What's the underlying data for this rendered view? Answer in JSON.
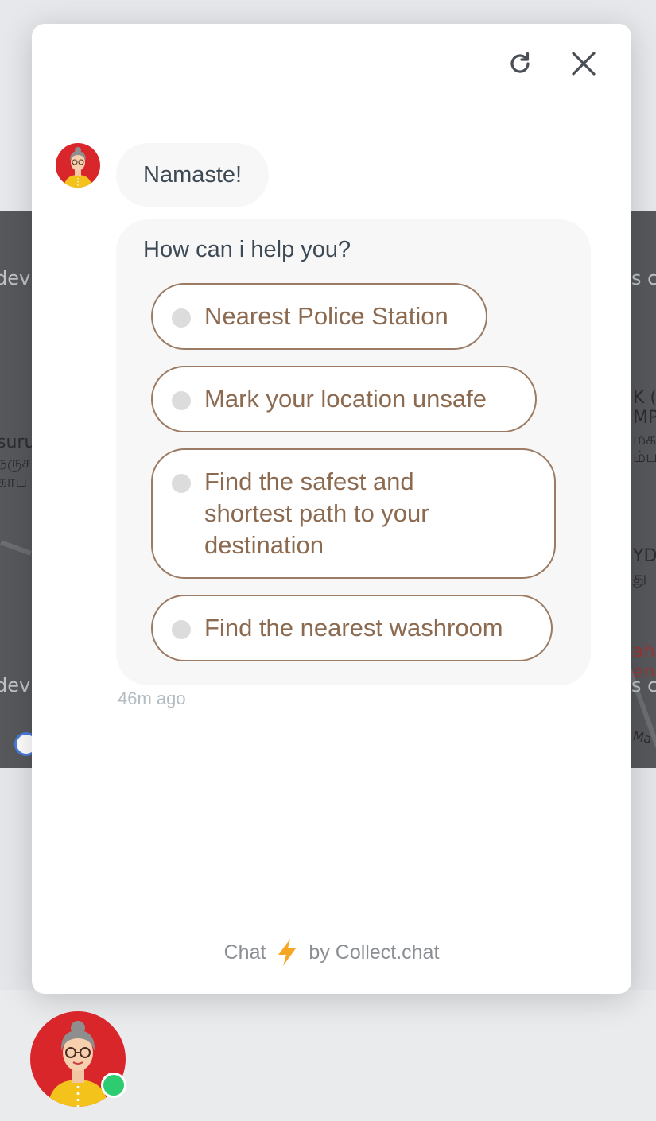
{
  "background": {
    "map_labels": [
      "dev",
      "dev",
      "s c",
      "s c",
      "suru",
      "நருச",
      "காப",
      "K (",
      "MP",
      "மக",
      "ம்ப",
      "YD",
      "து",
      "aha",
      "enc",
      "Ma"
    ]
  },
  "header": {
    "refresh_icon": "refresh-icon",
    "close_icon": "close-icon"
  },
  "chat": {
    "greeting": "Namaste!",
    "question": "How can i help you?",
    "options": [
      "Nearest Police Station",
      "Mark your location unsafe",
      "Find the safest and shortest path to your destination",
      "Find the nearest washroom"
    ],
    "timestamp": "46m ago"
  },
  "branding": {
    "prefix": "Chat",
    "icon": "lightning-icon",
    "suffix": "by Collect.chat"
  },
  "colors": {
    "option_border": "#9b7b63",
    "option_text": "#8c6a50",
    "bubble_bg": "#f7f7f7",
    "online": "#2ecc71",
    "avatar_bg": "#d9262a",
    "bolt": "#f5a623"
  }
}
